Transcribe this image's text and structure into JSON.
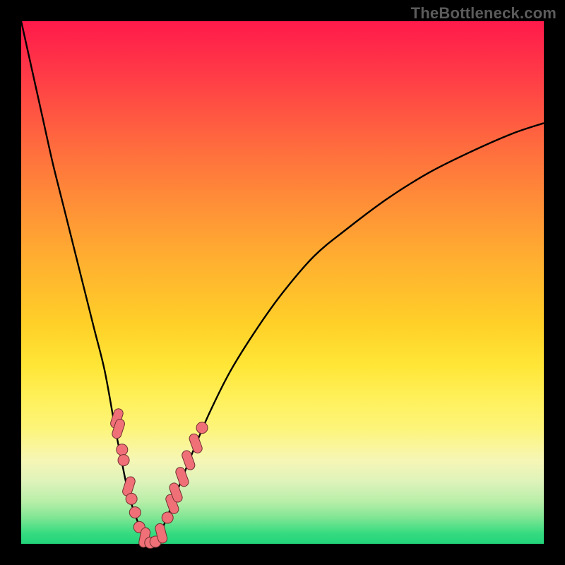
{
  "watermark": "TheBottleneck.com",
  "colors": {
    "frame_bg": "#000000",
    "curve_stroke": "#000000",
    "marker_fill": "#f07078",
    "marker_stroke": "#6f3030",
    "gradient_top": "#ff1a4b",
    "gradient_bottom": "#22d47a"
  },
  "chart_data": {
    "type": "line",
    "title": "",
    "xlabel": "",
    "ylabel": "",
    "xlim": [
      0,
      100
    ],
    "ylim": [
      0,
      100
    ],
    "grid": false,
    "series": [
      {
        "name": "left-curve",
        "x": [
          0,
          2,
          4,
          6,
          8,
          10,
          12,
          14,
          16,
          18,
          19,
          20,
          21,
          22,
          23,
          24,
          25
        ],
        "y": [
          100,
          91,
          82,
          73,
          65,
          57,
          49,
          41,
          33,
          22,
          17,
          12,
          8,
          5,
          2.5,
          1,
          0
        ]
      },
      {
        "name": "right-curve",
        "x": [
          25,
          26,
          27,
          28,
          29,
          31,
          33,
          36,
          40,
          45,
          50,
          56,
          62,
          70,
          78,
          86,
          94,
          100
        ],
        "y": [
          0,
          1.2,
          3,
          5.2,
          8,
          13,
          18,
          25,
          33,
          41,
          48,
          55,
          60,
          66,
          71,
          75,
          78.5,
          80.5
        ]
      }
    ],
    "markers": [
      {
        "x": 18.3,
        "y": 24.0,
        "shape": "rounded"
      },
      {
        "x": 18.6,
        "y": 22.0,
        "shape": "rounded"
      },
      {
        "x": 19.3,
        "y": 18.0,
        "shape": "round"
      },
      {
        "x": 19.6,
        "y": 16.0,
        "shape": "round"
      },
      {
        "x": 20.6,
        "y": 11.0,
        "shape": "rounded"
      },
      {
        "x": 21.1,
        "y": 8.6,
        "shape": "round"
      },
      {
        "x": 21.8,
        "y": 6.0,
        "shape": "round"
      },
      {
        "x": 22.6,
        "y": 3.2,
        "shape": "round"
      },
      {
        "x": 23.6,
        "y": 1.2,
        "shape": "rounded"
      },
      {
        "x": 24.7,
        "y": 0.2,
        "shape": "round"
      },
      {
        "x": 25.7,
        "y": 0.4,
        "shape": "round"
      },
      {
        "x": 26.8,
        "y": 2.0,
        "shape": "rounded"
      },
      {
        "x": 28.0,
        "y": 5.0,
        "shape": "round"
      },
      {
        "x": 28.9,
        "y": 7.6,
        "shape": "rounded"
      },
      {
        "x": 29.6,
        "y": 9.8,
        "shape": "rounded"
      },
      {
        "x": 30.8,
        "y": 12.8,
        "shape": "rounded"
      },
      {
        "x": 32.0,
        "y": 16.0,
        "shape": "rounded"
      },
      {
        "x": 33.4,
        "y": 19.2,
        "shape": "rounded"
      },
      {
        "x": 34.6,
        "y": 22.2,
        "shape": "round"
      }
    ]
  }
}
